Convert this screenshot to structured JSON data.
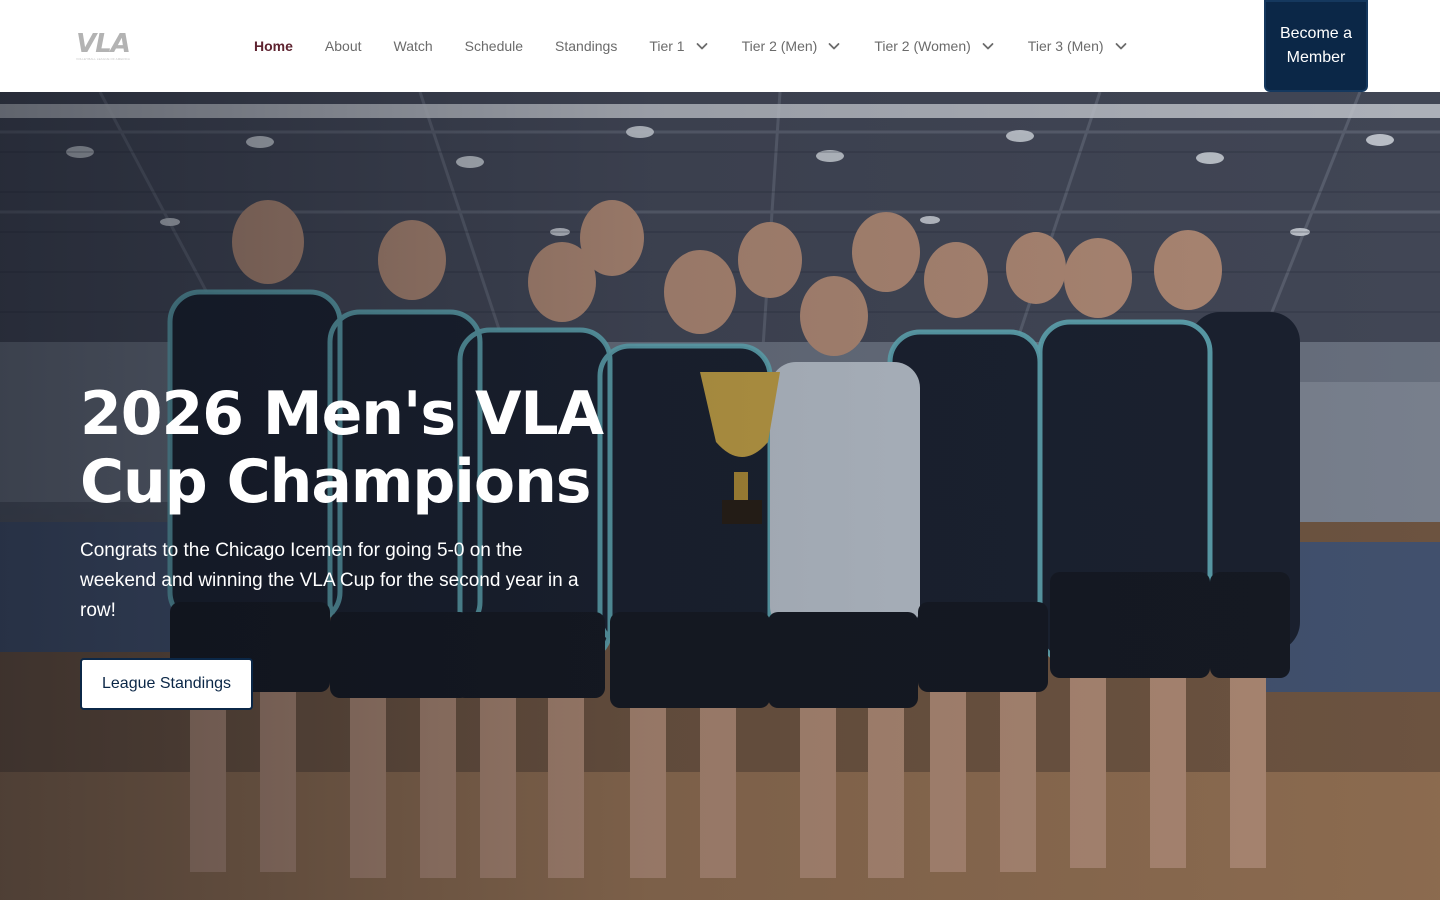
{
  "logo": {
    "mark": "VLA",
    "tagline": "VOLLEYBALL LEAGUE OF AMERICA"
  },
  "nav": {
    "items": [
      {
        "label": "Home",
        "active": true,
        "has_dropdown": false
      },
      {
        "label": "About",
        "active": false,
        "has_dropdown": false
      },
      {
        "label": "Watch",
        "active": false,
        "has_dropdown": false
      },
      {
        "label": "Schedule",
        "active": false,
        "has_dropdown": false
      },
      {
        "label": "Standings",
        "active": false,
        "has_dropdown": false
      },
      {
        "label": "Tier 1",
        "active": false,
        "has_dropdown": true
      },
      {
        "label": "Tier 2 (Men)",
        "active": false,
        "has_dropdown": true
      },
      {
        "label": "Tier 2 (Women)",
        "active": false,
        "has_dropdown": true
      },
      {
        "label": "Tier 3 (Men)",
        "active": false,
        "has_dropdown": true
      }
    ],
    "chevron_icon": "chevron-down-icon"
  },
  "header": {
    "cta_label": "Become a Member"
  },
  "hero": {
    "title": "2026 Men's VLA Cup Champions",
    "text": "Congrats to the Chicago Icemen for going 5-0 on the weekend and winning the VLA Cup for the second year in a row!",
    "button_label": "League Standings"
  },
  "colors": {
    "nav_active": "#5e2330",
    "nav_text": "#6b6b6b",
    "brand_navy": "#0b2747",
    "hero_text": "#ffffff"
  }
}
